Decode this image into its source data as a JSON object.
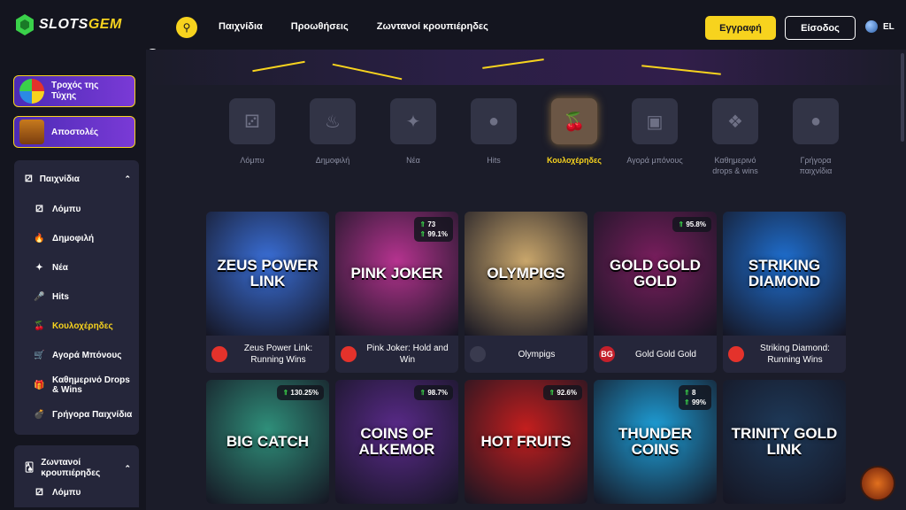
{
  "header": {
    "logo": {
      "part1": "SLOTS",
      "part2": "GEM"
    },
    "nav": [
      "Παιχνίδια",
      "Προωθήσεις",
      "Ζωντανοί κρουπιέρηδες"
    ],
    "register_label": "Εγγραφή",
    "login_label": "Είσοδος",
    "language": "EL"
  },
  "sidebar": {
    "promos": [
      {
        "label": "Τροχός της Τύχης"
      },
      {
        "label": "Αποστολές"
      }
    ],
    "games_section": {
      "title": "Παιχνίδια",
      "items": [
        {
          "label": "Λόμπυ",
          "icon": "dice-icon"
        },
        {
          "label": "Δημοφιλή",
          "icon": "fire-icon"
        },
        {
          "label": "Νέα",
          "icon": "sparkle-icon"
        },
        {
          "label": "Hits",
          "icon": "microphone-icon"
        },
        {
          "label": "Κουλοχέρηδες",
          "icon": "cherry-icon",
          "active": true
        },
        {
          "label": "Αγορά Μπόνους",
          "icon": "shop-icon"
        },
        {
          "label": "Καθημερινό Drops & Wins",
          "icon": "drops-icon"
        },
        {
          "label": "Γρήγορα Παιχνίδια",
          "icon": "bomb-icon"
        }
      ]
    },
    "live_section": {
      "title": "Ζωντανοί κρουπιέρηδες",
      "items": [
        {
          "label": "Λόμπυ"
        }
      ]
    }
  },
  "categories": [
    {
      "label": "Λόμπυ",
      "icon": "dice-icon"
    },
    {
      "label": "Δημοφιλή",
      "icon": "fire-icon"
    },
    {
      "label": "Νέα",
      "icon": "sparkle-icon"
    },
    {
      "label": "Hits",
      "icon": "microphone-icon"
    },
    {
      "label": "Κουλοχέρηδες",
      "icon": "cherry-icon",
      "active": true
    },
    {
      "label": "Αγορά μπόνους",
      "icon": "shop-icon"
    },
    {
      "label": "Καθημερινό drops & wins",
      "icon": "drops-icon"
    },
    {
      "label": "Γρήγορα παιχνίδια",
      "icon": "bomb-icon"
    }
  ],
  "games_row1": [
    {
      "title": "ZEUS POWER LINK",
      "name": "Zeus Power Link: Running Wins",
      "bg": "#3a6fd8",
      "provider_color": "#e4322b"
    },
    {
      "title": "PINK JOKER",
      "name": "Pink Joker: Hold and Win",
      "bg": "#b5338f",
      "provider_color": "#e4322b",
      "badge": {
        "a": "73",
        "b": "99.1%"
      }
    },
    {
      "title": "OLYMPIGS",
      "name": "Olympigs",
      "bg": "#c9a66b",
      "provider_color": "#3a3b4f"
    },
    {
      "title": "GOLD GOLD GOLD",
      "name": "Gold Gold Gold",
      "bg": "#7a1e5e",
      "provider_color": "#c4202b",
      "provider_text": "BG",
      "badge": {
        "a": "95.8%"
      }
    },
    {
      "title": "STRIKING DIAMOND",
      "name": "Striking Diamond: Running Wins",
      "bg": "#1f6fd0",
      "provider_color": "#e4322b"
    }
  ],
  "games_row2": [
    {
      "title": "BIG CATCH",
      "bg": "#2f8f7a",
      "badge": {
        "a": "130.25%"
      }
    },
    {
      "title": "COINS OF ALKEMOR",
      "bg": "#5a2a8a",
      "badge": {
        "a": "98.7%"
      }
    },
    {
      "title": "HOT FRUITS",
      "bg": "#c41e1e",
      "badge": {
        "a": "92.6%"
      }
    },
    {
      "title": "THUNDER COINS",
      "bg": "#1e9fd8",
      "badge": {
        "a": "8",
        "b": "99%"
      }
    },
    {
      "title": "TRINITY GOLD LINK",
      "bg": "#1e3a5a"
    }
  ]
}
